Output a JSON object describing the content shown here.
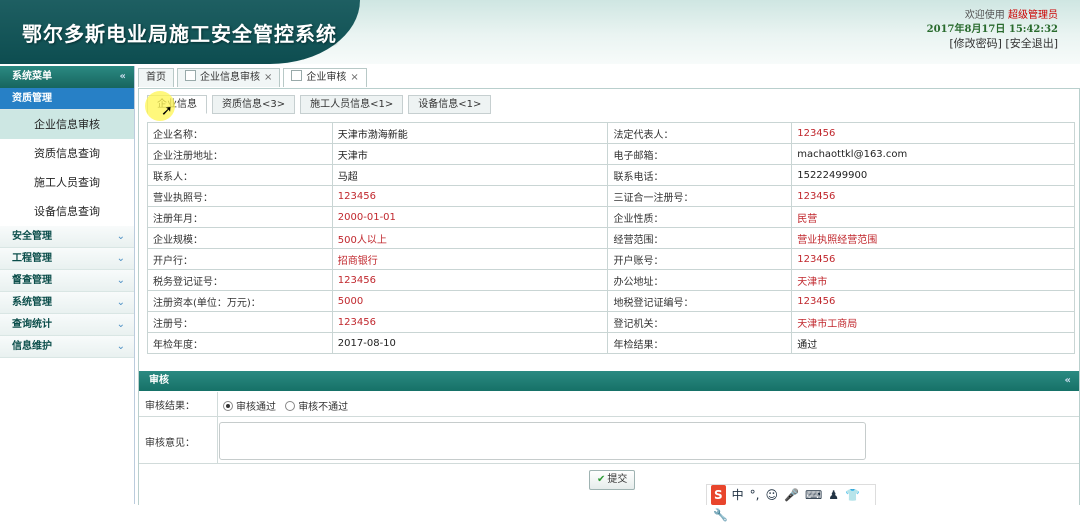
{
  "header": {
    "title": "鄂尔多斯电业局施工安全管控系统",
    "welcome": "欢迎使用",
    "user": "超级管理员",
    "datetime": "2017年8月17日 15:42:32",
    "change_password": "[修改密码]",
    "logout": "[安全退出]"
  },
  "sidebar": {
    "heading": "系统菜单",
    "active_group": "资质管理",
    "items": [
      "企业信息审核",
      "资质信息查询",
      "施工人员查询",
      "设备信息查询"
    ],
    "groups": [
      "安全管理",
      "工程管理",
      "督查管理",
      "系统管理",
      "查询统计",
      "信息维护"
    ]
  },
  "toptabs": [
    {
      "label": "首页",
      "closable": false
    },
    {
      "label": "企业信息审核",
      "closable": true
    },
    {
      "label": "企业审核",
      "closable": true
    }
  ],
  "subtabs": [
    "企业信息",
    "资质信息<3>",
    "施工人员信息<1>",
    "设备信息<1>"
  ],
  "info": {
    "rows": [
      [
        {
          "label": "企业名称：",
          "value": "天津市渤海新能",
          "red": false
        },
        {
          "label": "法定代表人：",
          "value": "123456",
          "red": true
        }
      ],
      [
        {
          "label": "企业注册地址：",
          "value": "天津市",
          "red": false
        },
        {
          "label": "电子邮箱：",
          "value": "machaottkl@163.com",
          "red": false
        }
      ],
      [
        {
          "label": "联系人：",
          "value": "马超",
          "red": false
        },
        {
          "label": "联系电话：",
          "value": "15222499900",
          "red": false
        }
      ],
      [
        {
          "label": "营业执照号：",
          "value": "123456",
          "red": true
        },
        {
          "label": "三证合一注册号：",
          "value": "123456",
          "red": true
        }
      ],
      [
        {
          "label": "注册年月：",
          "value": "2000-01-01",
          "red": true
        },
        {
          "label": "企业性质：",
          "value": "民营",
          "red": true
        }
      ],
      [
        {
          "label": "企业规模：",
          "value": "500人以上",
          "red": true
        },
        {
          "label": "经营范围：",
          "value": "营业执照经营范围",
          "red": true
        }
      ],
      [
        {
          "label": "开户行：",
          "value": "招商银行",
          "red": true
        },
        {
          "label": "开户账号：",
          "value": "123456",
          "red": true
        }
      ],
      [
        {
          "label": "税务登记证号：",
          "value": "123456",
          "red": true
        },
        {
          "label": "办公地址：",
          "value": "天津市",
          "red": true
        }
      ],
      [
        {
          "label": "注册资本(单位：万元)：",
          "value": "5000",
          "red": true
        },
        {
          "label": "地税登记证编号：",
          "value": "123456",
          "red": true
        }
      ],
      [
        {
          "label": "注册号：",
          "value": "123456",
          "red": true
        },
        {
          "label": "登记机关：",
          "value": "天津市工商局",
          "red": true
        }
      ],
      [
        {
          "label": "年检年度：",
          "value": "2017-08-10",
          "red": false
        },
        {
          "label": "年检结果：",
          "value": "通过",
          "red": false
        }
      ]
    ]
  },
  "audit": {
    "heading": "审核",
    "result_label": "审核结果：",
    "option_pass": "审核通过",
    "option_fail": "审核不通过",
    "selected": "审核通过",
    "opinion_label": "审核意见：",
    "opinion_value": "",
    "submit": "提交"
  },
  "ime": {
    "brand": "S",
    "mode": "中"
  },
  "colors": {
    "header_dark": "#0d4d50",
    "nav_active": "#2780c6",
    "panel_head": "#167167",
    "value_red": "#c0272d"
  }
}
